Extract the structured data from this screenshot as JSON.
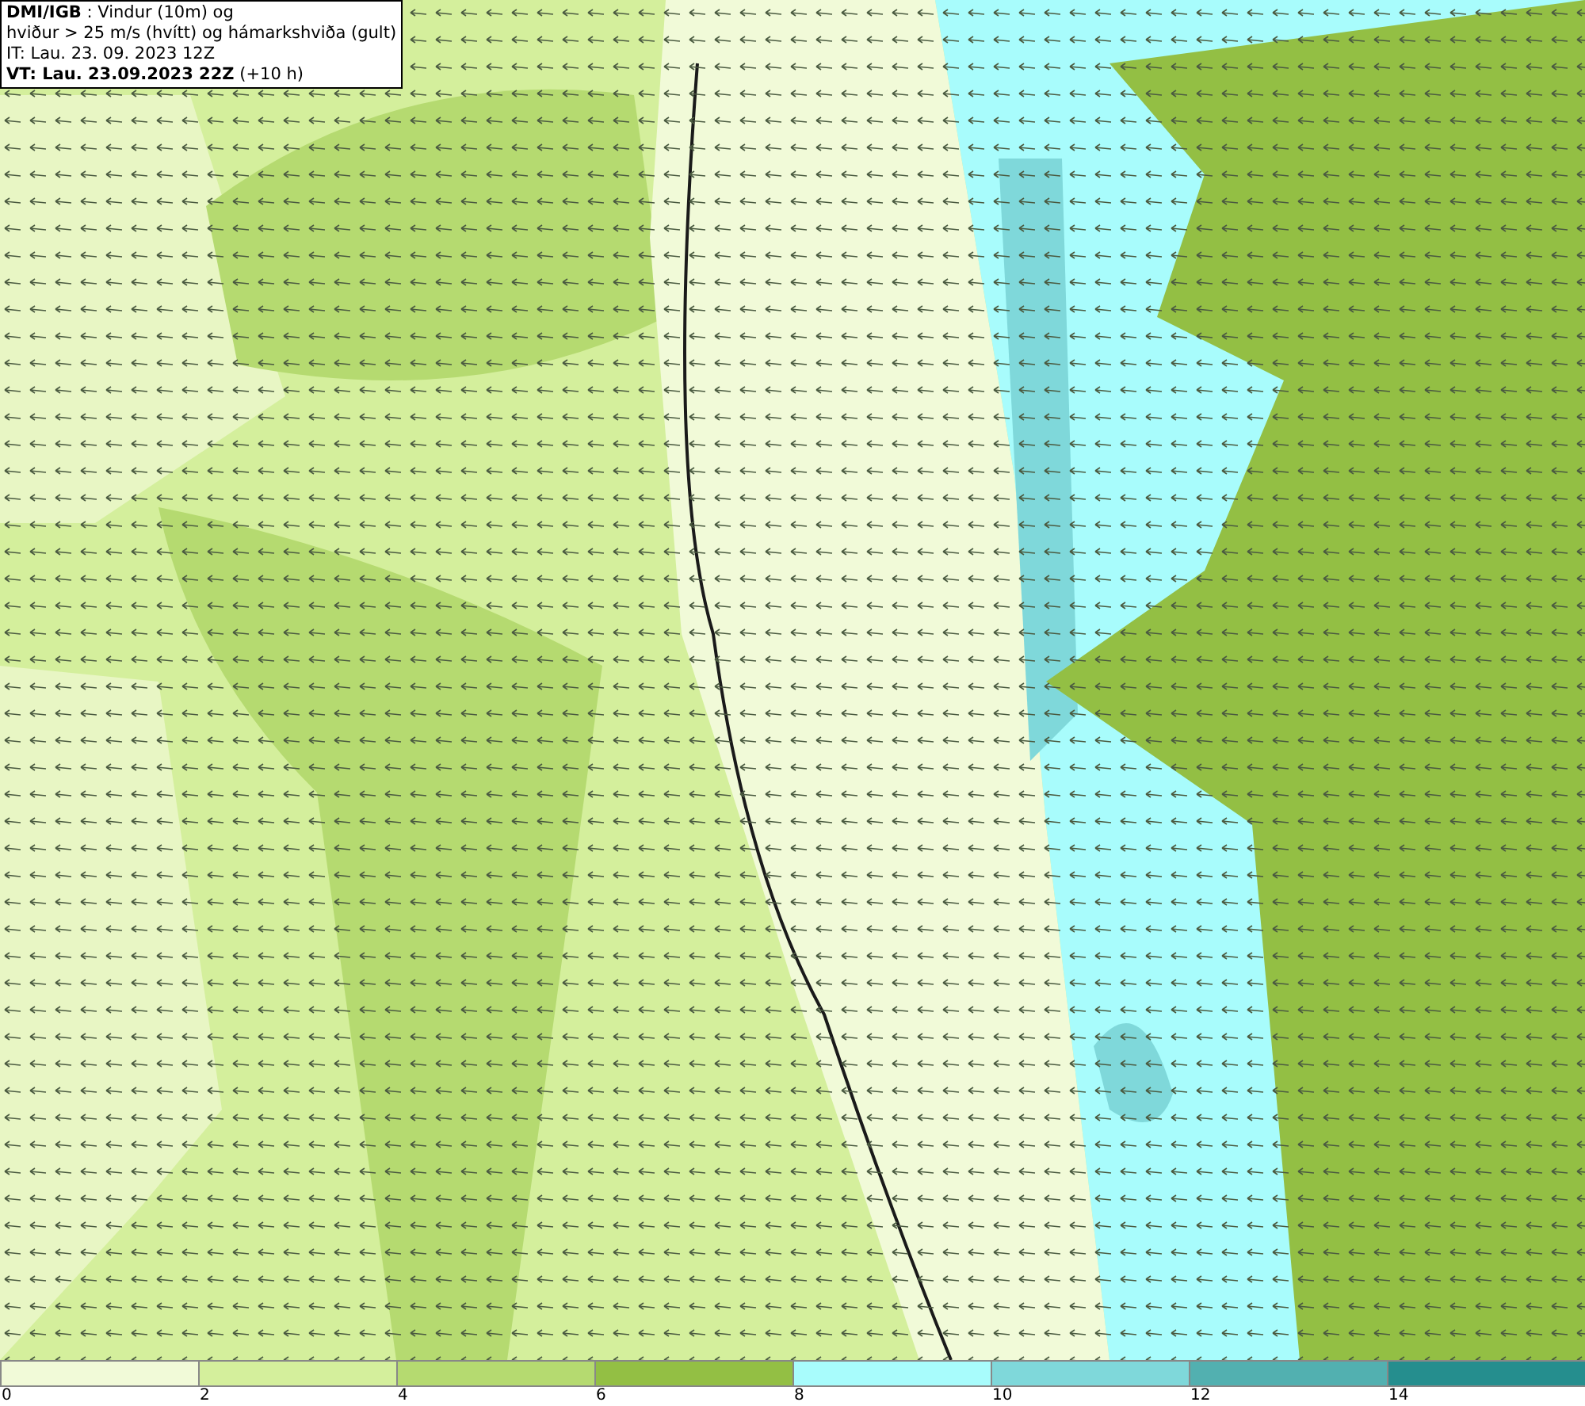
{
  "title_box": {
    "lines": [
      "**DMI/IGB** : Vindur (10m) og",
      "hviður > 25 m/s (hvítt) og hámarkshviða (gult)",
      "IT: Lau. 23. 09. 2023 12Z",
      "**VT: Lau. 23.09.2023 22Z** (+10 h)"
    ]
  },
  "legend": {
    "bins": [
      {
        "color": "#f1fad8"
      },
      {
        "color": "#d4ef9c"
      },
      {
        "color": "#b5da70"
      },
      {
        "color": "#93bf44"
      },
      {
        "color": "#a8fcfc"
      },
      {
        "color": "#7fd8da"
      },
      {
        "color": "#52b0b0"
      },
      {
        "color": "#258e8e"
      }
    ],
    "ticks": [
      "0",
      "2",
      "4",
      "6",
      "8",
      "10",
      "12",
      "14"
    ]
  }
}
